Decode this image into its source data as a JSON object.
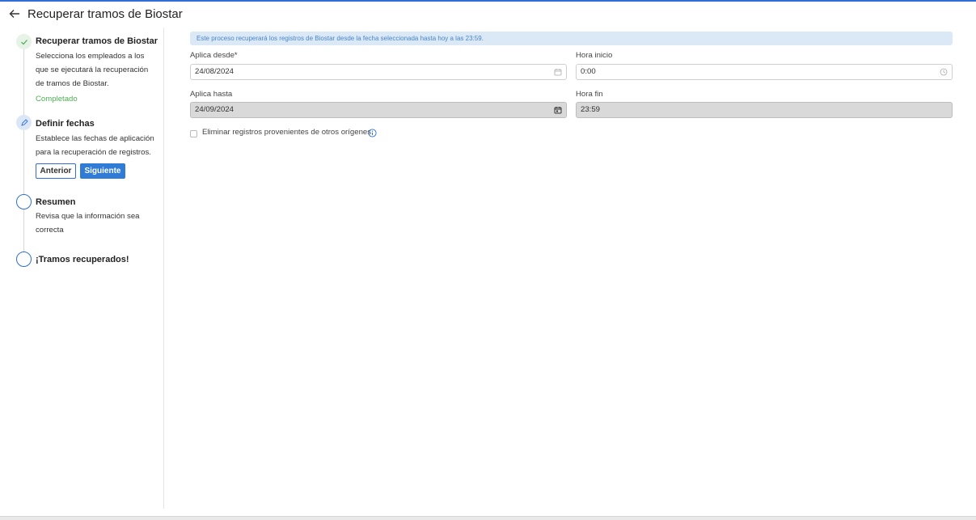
{
  "header": {
    "title": "Recuperar tramos de Biostar",
    "back_icon": "arrow-left-icon"
  },
  "steps": [
    {
      "title": "Recuperar tramos de Biostar",
      "desc_lines": [
        "Selecciona los empleados a los",
        "que se ejecutará la recuperación",
        "de tramos de Biostar."
      ],
      "status": "Completado",
      "icon": "check-icon"
    },
    {
      "title": "Definir fechas",
      "desc_lines": [
        "Establece las fechas de aplicación",
        "para la recuperación de registros."
      ],
      "icon": "pencil-icon",
      "buttons": {
        "previous": "Anterior",
        "next": "Siguiente"
      }
    },
    {
      "title": "Resumen",
      "desc_lines": [
        "Revisa que la información sea",
        "correcta"
      ],
      "icon": "empty-circle-icon"
    },
    {
      "title": "¡Tramos recuperados!",
      "icon": "empty-circle-icon"
    }
  ],
  "info_banner": "Este proceso recuperará los registros de Biostar desde la fecha seleccionada hasta hoy a las 23:59.",
  "form": {
    "from_label": "Aplica desde*",
    "from_value": "24/08/2024",
    "start_time_label": "Hora inicio",
    "start_time_value": "0:00",
    "to_label": "Aplica hasta",
    "to_value": "24/09/2024",
    "end_time_label": "Hora fin",
    "end_time_value": "23:59",
    "checkbox_label": "Eliminar registros provenientes de otros orígenes",
    "checkbox_checked": false
  },
  "colors": {
    "accent": "#2f7bd6",
    "success": "#4caf50",
    "banner_bg": "#dbe8f6",
    "banner_text": "#4a86c8"
  }
}
